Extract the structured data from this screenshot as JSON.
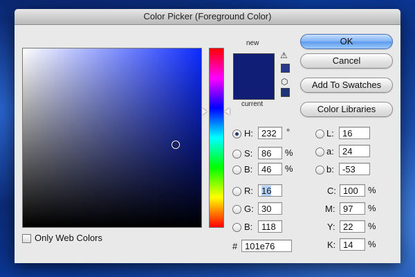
{
  "window": {
    "title": "Color Picker (Foreground Color)"
  },
  "colors": {
    "new": "#101e76",
    "current": "#101e76",
    "out_of_gamut": "#2a3a8a",
    "web_safe": "#1d3575"
  },
  "preview": {
    "new_label": "new",
    "current_label": "current"
  },
  "buttons": {
    "ok": "OK",
    "cancel": "Cancel",
    "add_to_swatches": "Add To Swatches",
    "color_libraries": "Color Libraries"
  },
  "hsb": {
    "h": {
      "label": "H:",
      "value": "232",
      "unit": "°"
    },
    "s": {
      "label": "S:",
      "value": "86",
      "unit": "%"
    },
    "b": {
      "label": "B:",
      "value": "46",
      "unit": "%"
    }
  },
  "rgb": {
    "r": {
      "label": "R:",
      "value": "16"
    },
    "g": {
      "label": "G:",
      "value": "30"
    },
    "b": {
      "label": "B:",
      "value": "118"
    }
  },
  "lab": {
    "l": {
      "label": "L:",
      "value": "16"
    },
    "a": {
      "label": "a:",
      "value": "24"
    },
    "b": {
      "label": "b:",
      "value": "-53"
    }
  },
  "cmyk": {
    "c": {
      "label": "C:",
      "value": "100",
      "unit": "%"
    },
    "m": {
      "label": "M:",
      "value": "97",
      "unit": "%"
    },
    "y": {
      "label": "Y:",
      "value": "22",
      "unit": "%"
    },
    "k": {
      "label": "K:",
      "value": "14",
      "unit": "%"
    }
  },
  "hex": {
    "label": "#",
    "value": "101e76"
  },
  "options": {
    "only_web_colors": "Only Web Colors"
  },
  "icons": {
    "gamut_warning": "warning-triangle-icon",
    "web_safe_warning": "cube-icon"
  }
}
